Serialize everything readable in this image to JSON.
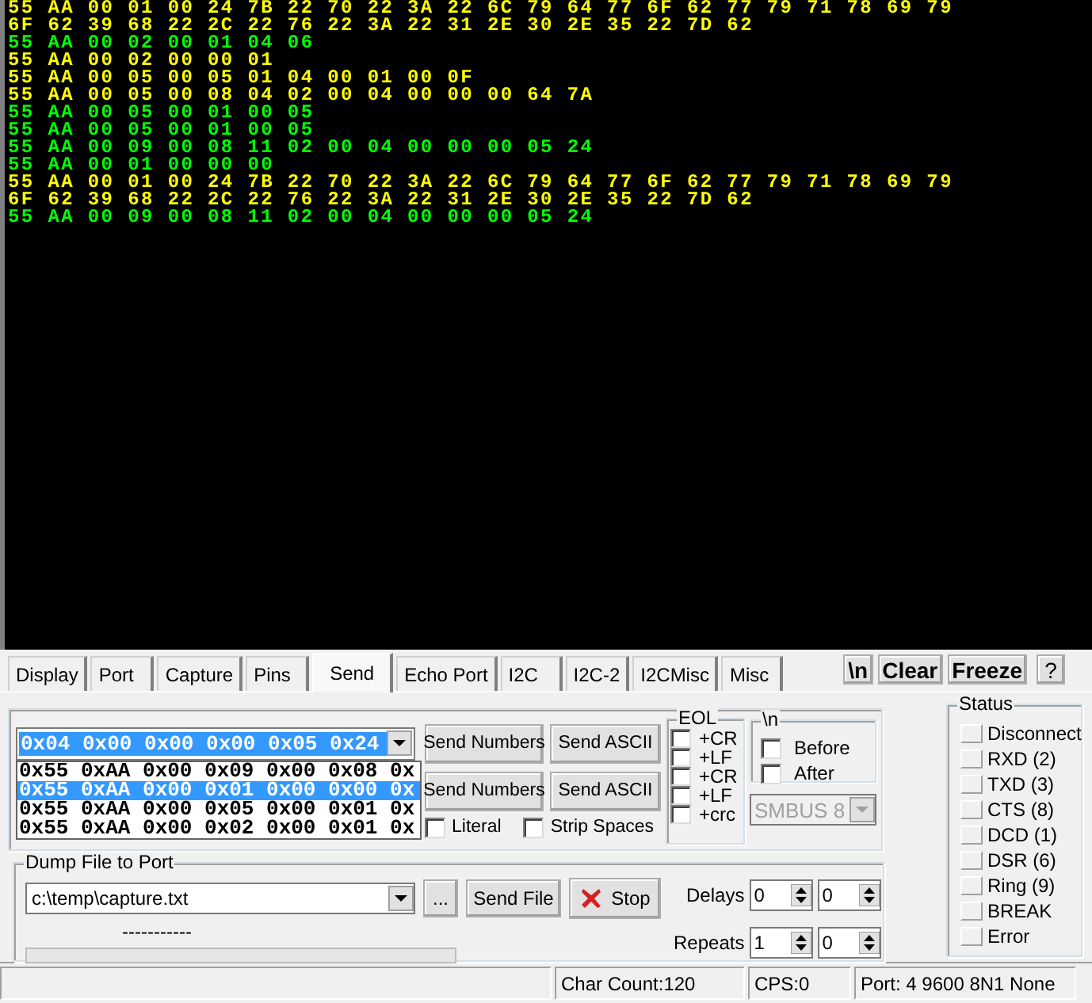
{
  "terminal": {
    "lines": [
      {
        "text": "55 AA 00 01 00 24 7B 22 70 22 3A 22 6C 79 64 77 6F 62 77 79 71 78 69 79",
        "color": "#ffff00"
      },
      {
        "text": "6F 62 39 68 22 2C 22 76 22 3A 22 31 2E 30 2E 35 22 7D 62",
        "color": "#ffff00"
      },
      {
        "text": "55 AA 00 02 00 01 04 06",
        "color": "#00ff00"
      },
      {
        "text": "55 AA 00 02 00 00 01",
        "color": "#ffff00"
      },
      {
        "text": "55 AA 00 05 00 05 01 04 00 01 00 0F",
        "color": "#ffff00"
      },
      {
        "text": "55 AA 00 05 00 08 04 02 00 04 00 00 00 64 7A",
        "color": "#ffff00"
      },
      {
        "text": "55 AA 00 05 00 01 00 05",
        "color": "#00ff00"
      },
      {
        "text": "55 AA 00 05 00 01 00 05",
        "color": "#00ff00"
      },
      {
        "text": "55 AA 00 09 00 08 11 02 00 04 00 00 00 05 24",
        "color": "#00ff00"
      },
      {
        "text": "55 AA 00 01 00 00 00",
        "color": "#00ff00"
      },
      {
        "text": "55 AA 00 01 00 24 7B 22 70 22 3A 22 6C 79 64 77 6F 62 77 79 71 78 69 79",
        "color": "#ffff00"
      },
      {
        "text": "6F 62 39 68 22 2C 22 76 22 3A 22 31 2E 30 2E 35 22 7D 62",
        "color": "#ffff00"
      },
      {
        "text": "55 AA 00 09 00 08 11 02 00 04 00 00 00 05 24",
        "color": "#00ff00"
      }
    ]
  },
  "tabs": [
    {
      "label": "Display",
      "selected": false
    },
    {
      "label": "Port",
      "selected": false
    },
    {
      "label": "Capture",
      "selected": false
    },
    {
      "label": "Pins",
      "selected": false
    },
    {
      "label": "Send",
      "selected": true
    },
    {
      "label": "Echo Port",
      "selected": false
    },
    {
      "label": "I2C",
      "selected": false
    },
    {
      "label": "I2C-2",
      "selected": false
    },
    {
      "label": "I2CMisc",
      "selected": false
    },
    {
      "label": "Misc",
      "selected": false
    }
  ],
  "toolbar_buttons": [
    "\\n",
    "Clear",
    "Freeze",
    "?"
  ],
  "send": {
    "combo": {
      "value": "0x04 0x00 0x00 0x00 0x05 0x24",
      "expanded": true
    },
    "history": [
      {
        "text": "0x55 0xAA 0x00 0x09 0x00 0x08 0x",
        "selected": false
      },
      {
        "text": "0x55 0xAA 0x00 0x01 0x00 0x00 0x",
        "selected": true
      },
      {
        "text": "0x55 0xAA 0x00 0x05 0x00 0x01 0x",
        "selected": false
      },
      {
        "text": "0x55 0xAA 0x00 0x02 0x00 0x01 0x",
        "selected": false
      }
    ],
    "buttons": [
      "Send Numbers",
      "Send ASCII",
      "Send Numbers",
      "Send ASCII"
    ],
    "options": [
      {
        "label": "Literal",
        "checked": false
      },
      {
        "label": "Strip Spaces",
        "checked": false
      }
    ],
    "eol": {
      "title": "EOL",
      "options": [
        {
          "label": "+CR",
          "checked": false
        },
        {
          "label": "+LF",
          "checked": false
        },
        {
          "label": "+CR",
          "checked": false
        },
        {
          "label": "+LF",
          "checked": false
        },
        {
          "label": "+crc",
          "checked": false
        }
      ]
    },
    "newline": {
      "title": "\\n",
      "options": [
        {
          "label": "Before",
          "checked": false
        },
        {
          "label": "After",
          "checked": false
        }
      ]
    },
    "smbus": {
      "value": "SMBUS 8",
      "disabled": true
    }
  },
  "dump": {
    "title": "Dump File to Port",
    "file": "c:\\temp\\capture.txt",
    "browse": "...",
    "send_file": "Send File",
    "stop": "Stop",
    "delays_label": "Delays",
    "delays": [
      "0",
      "0"
    ],
    "progress_text": "-----------",
    "progress": {
      "level": 0
    },
    "repeats_label": "Repeats",
    "repeats": [
      "1",
      "0"
    ]
  },
  "status": {
    "title": "Status",
    "items": [
      {
        "label": "Disconnect",
        "on": false
      },
      {
        "label": "RXD (2)",
        "on": false
      },
      {
        "label": "TXD (3)",
        "on": false
      },
      {
        "label": "CTS (8)",
        "on": false
      },
      {
        "label": "DCD (1)",
        "on": false
      },
      {
        "label": "DSR (6)",
        "on": false
      },
      {
        "label": "Ring (9)",
        "on": false
      },
      {
        "label": "BREAK",
        "on": false
      },
      {
        "label": "Error",
        "on": false
      }
    ]
  },
  "status_bar": [
    "Char Count:120",
    "CPS:0",
    "Port: 4 9600 8N1 None"
  ]
}
